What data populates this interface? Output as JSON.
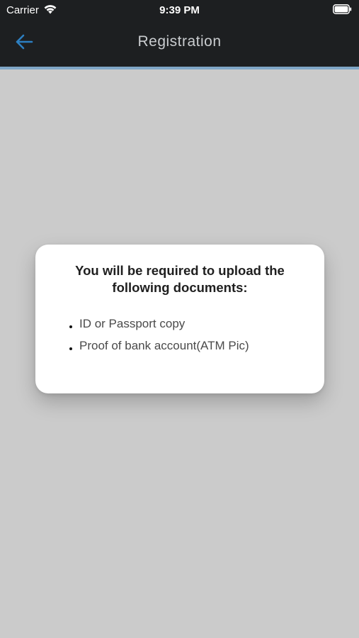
{
  "status_bar": {
    "carrier": "Carrier",
    "time": "9:39 PM"
  },
  "header": {
    "title": "Registration",
    "back_icon": "arrow-left-icon",
    "accent_color": "#2d7fc1"
  },
  "dialog": {
    "title": "You will be required to upload the following documents:",
    "items": [
      "ID or Passport copy",
      "Proof of bank account(ATM Pic)"
    ]
  }
}
